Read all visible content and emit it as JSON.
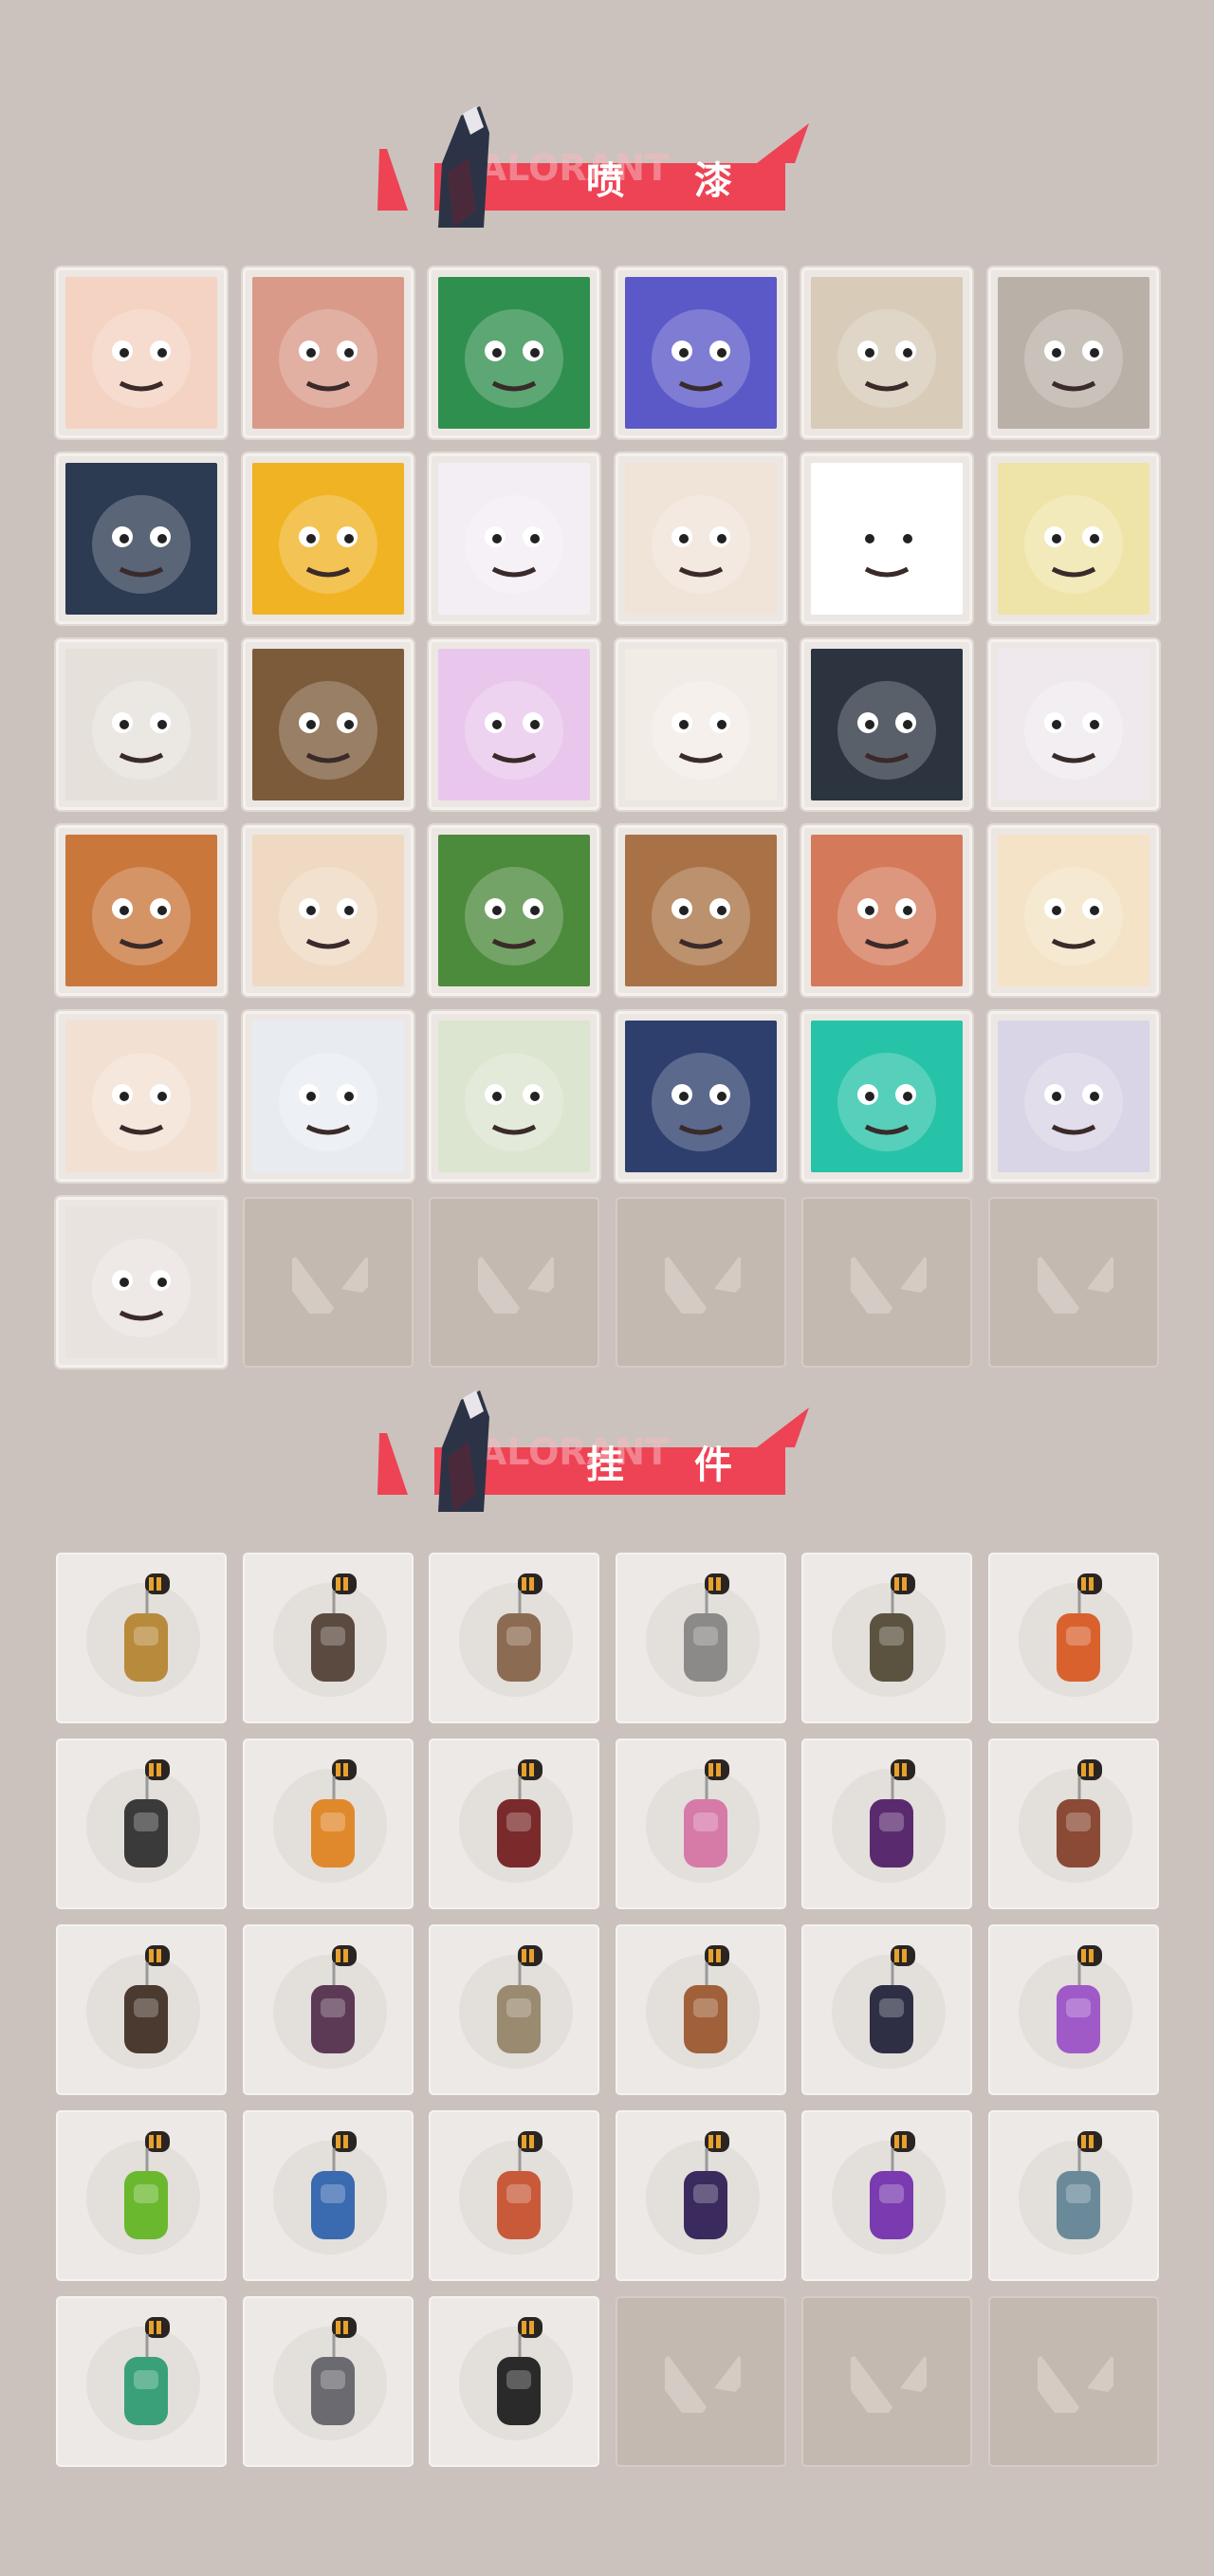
{
  "banner_watermark": "VALORANT",
  "sections": {
    "sprays": {
      "title": "喷 漆"
    },
    "charms": {
      "title": "挂 件"
    }
  },
  "sprays": [
    {
      "icon": "flower-face-spray-icon",
      "bg": "#f4d3c2"
    },
    {
      "icon": "angry-face-spray-icon",
      "bg": "#d99a8a"
    },
    {
      "icon": "green-mask-spray-icon",
      "bg": "#2f8f4e"
    },
    {
      "icon": "purple-arm-spray-icon",
      "bg": "#5b58c8"
    },
    {
      "icon": "penguin-beanie-spray-icon",
      "bg": "#d8cbb8"
    },
    {
      "icon": "robot-eye-spray-icon",
      "bg": "#b9b1a8"
    },
    {
      "icon": "star-badge-spray-icon",
      "bg": "#2c3a52"
    },
    {
      "icon": "yellow-mask-spray-icon",
      "bg": "#f0b323"
    },
    {
      "icon": "purple-graffiti-spray-icon",
      "bg": "#f2eef4"
    },
    {
      "icon": "goggles-face-spray-icon",
      "bg": "#f0e3d8"
    },
    {
      "icon": "chevron-stripes-spray-icon",
      "bg": "#ffffff"
    },
    {
      "icon": "sleepy-horn-spray-icon",
      "bg": "#efe4a8"
    },
    {
      "icon": "pixel-man-spray-icon",
      "bg": "#e6e0da"
    },
    {
      "icon": "armored-face-spray-icon",
      "bg": "#7b5b3a"
    },
    {
      "icon": "purple-ghost-spray-icon",
      "bg": "#e9c7ec"
    },
    {
      "icon": "clown-face-spray-icon",
      "bg": "#f2ece6"
    },
    {
      "icon": "orange-eye-spray-icon",
      "bg": "#2c3440"
    },
    {
      "icon": "raccoon-spray-icon",
      "bg": "#efe9ee"
    },
    {
      "icon": "bearded-grin-spray-icon",
      "bg": "#c9773b"
    },
    {
      "icon": "black-hair-boy-spray-icon",
      "bg": "#f0d9c2"
    },
    {
      "icon": "green-crate-spray-icon",
      "bg": "#4c8a3c"
    },
    {
      "icon": "green-eyes-spray-icon",
      "bg": "#a87246"
    },
    {
      "icon": "crying-creature-spray-icon",
      "bg": "#d47a5a"
    },
    {
      "icon": "tiger-spray-icon",
      "bg": "#f4e3c6"
    },
    {
      "icon": "pencil-girl-spray-icon",
      "bg": "#f2e0d2"
    },
    {
      "icon": "beanie-penguin-spray-icon",
      "bg": "#e8ecf1"
    },
    {
      "icon": "frog-hat-spray-icon",
      "bg": "#dce5cf"
    },
    {
      "icon": "hooded-girl-spray-icon",
      "bg": "#2e3f6e"
    },
    {
      "icon": "valorant-teal-spray-icon",
      "bg": "#27c3a8"
    },
    {
      "icon": "graffiti-letters-spray-icon",
      "bg": "#d9d4e6"
    },
    {
      "icon": "red-valorant-circle-spray-icon",
      "bg": "#e9e3df"
    }
  ],
  "charms": [
    {
      "icon": "golden-cat-charm-icon",
      "color": "#b88a3b"
    },
    {
      "icon": "drone-charm-icon",
      "color": "#5a4a40"
    },
    {
      "icon": "cake-tray-charm-icon",
      "color": "#8b6b52"
    },
    {
      "icon": "raccoon-charm-icon",
      "color": "#8c8a88"
    },
    {
      "icon": "pouch-charm-icon",
      "color": "#5b5340"
    },
    {
      "icon": "canister-charm-icon",
      "color": "#d9612e"
    },
    {
      "icon": "sword-charm-icon",
      "color": "#3a3a3a"
    },
    {
      "icon": "chili-charm-icon",
      "color": "#e0892c"
    },
    {
      "icon": "rope-charm-icon",
      "color": "#7a2a2a"
    },
    {
      "icon": "cupcake-charm-icon",
      "color": "#d67aa8"
    },
    {
      "icon": "medal-charm-icon",
      "color": "#5a2a6e"
    },
    {
      "icon": "bear-charm-icon",
      "color": "#8a4a35"
    },
    {
      "icon": "crate-gun-charm-icon",
      "color": "#4a3a30"
    },
    {
      "icon": "agent-figure-charm-icon",
      "color": "#5c3a55"
    },
    {
      "icon": "cowboy-charm-icon",
      "color": "#9a8a70"
    },
    {
      "icon": "box-charm-icon",
      "color": "#a0603a"
    },
    {
      "icon": "mech-charm-icon",
      "color": "#2e2f45"
    },
    {
      "icon": "lava-lamp-charm-icon",
      "color": "#a05ac8"
    },
    {
      "icon": "pager-charm-icon",
      "color": "#6ab82e"
    },
    {
      "icon": "astronaut-charm-icon",
      "color": "#3a6ab0"
    },
    {
      "icon": "radio-charm-icon",
      "color": "#c85a3a"
    },
    {
      "icon": "medal-charm-icon-2",
      "color": "#3a2a5e"
    },
    {
      "icon": "heart-charm-icon",
      "color": "#7a3ab0"
    },
    {
      "icon": "robot-girl-charm-icon",
      "color": "#6a8a9a"
    },
    {
      "icon": "can-charm-icon",
      "color": "#3aa07a"
    },
    {
      "icon": "hedgehog-charm-icon",
      "color": "#6a6a70"
    },
    {
      "icon": "valorant-token-charm-icon",
      "color": "#2a2a2a"
    }
  ],
  "colors": {
    "background": "#cbc2bd",
    "banner_red": "#ee4354",
    "empty_tile": "#c4b9b0"
  }
}
